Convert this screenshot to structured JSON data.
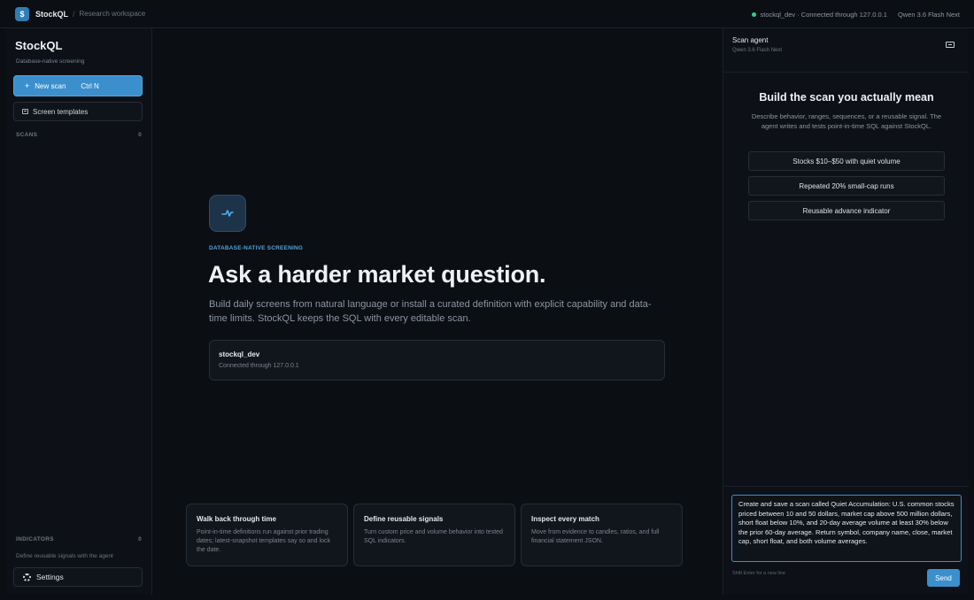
{
  "topbar": {
    "brand": "StockQL",
    "logo_glyph": "$",
    "separator": "/",
    "breadcrumb": "Research workspace",
    "connection_status": "stockql_dev · Connected through 127.0.0.1",
    "model": "Qwen 3.6 Flash Next",
    "status_color": "#2fd08d"
  },
  "sidebar": {
    "title": "StockQL",
    "subtitle": "Database-native screening",
    "new_scan_label": "New scan",
    "new_scan_shortcut": "Ctrl N",
    "templates_label": "Screen templates",
    "scans_header": "SCANS",
    "scans_count": "0",
    "indicators_header": "INDICATORS",
    "indicators_count": "0",
    "indicators_note": "Define reusable signals with the agent",
    "settings_label": "Settings"
  },
  "main": {
    "icon": "pulse-icon",
    "eyebrow": "DATABASE-NATIVE SCREENING",
    "headline": "Ask a harder market question.",
    "lead": "Build daily screens from natural language or install a curated definition with explicit capability and data-time limits. StockQL keeps the SQL with every editable scan.",
    "connection": {
      "name": "stockql_dev",
      "detail": "Connected through 127.0.0.1"
    },
    "features": [
      {
        "title": "Walk back through time",
        "body": "Point-in-time definitions run against prior trading dates; latest-snapshot templates say so and lock the date."
      },
      {
        "title": "Define reusable signals",
        "body": "Turn custom price and volume behavior into tested SQL indicators."
      },
      {
        "title": "Inspect every match",
        "body": "Move from evidence to candles, ratios, and full financial statement JSON."
      }
    ]
  },
  "agent": {
    "title": "Scan agent",
    "model": "Qwen 3.6 Flash Next",
    "heading": "Build the scan you actually mean",
    "description": "Describe behavior, ranges, sequences, or a reusable signal. The agent writes and tests point-in-time SQL against StockQL.",
    "suggestions": [
      "Stocks $10–$50 with quiet volume",
      "Repeated 20% small-cap runs",
      "Reusable advance indicator"
    ],
    "prompt_value": "Create and save a scan called Quiet Accumulation: U.S. common stocks priced between 10 and 50 dollars, market cap above 500 million dollars, short float below 10%, and 20-day average volume at least 30% below the prior 60-day average. Return symbol, company name, close, market cap, short float, and both volume averages.",
    "hint": "Shift Enter for a new line",
    "send_label": "Send"
  },
  "colors": {
    "accent": "#3b8fcd",
    "eyebrow": "#4fa0dc",
    "background": "#0b0e13"
  }
}
